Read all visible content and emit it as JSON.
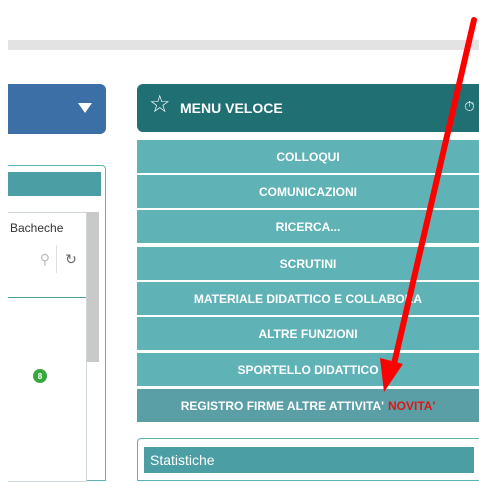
{
  "left": {
    "bacheche": "Bacheche",
    "badge": "8"
  },
  "menu_veloce": {
    "title": "MENU VELOCE",
    "items": [
      {
        "label": "COLLOQUI"
      },
      {
        "label": "COMUNICAZIONI"
      },
      {
        "label": "RICERCA..."
      },
      {
        "label": "SCRUTINI"
      },
      {
        "label": "MATERIALE DIDATTICO E COLLABORA"
      },
      {
        "label": "ALTRE FUNZIONI"
      },
      {
        "label": "SPORTELLO DIDATTICO"
      },
      {
        "label": "REGISTRO FIRME ALTRE ATTIVITA'",
        "tag": "NOVITA'"
      }
    ]
  },
  "stats": {
    "title": "Statistiche"
  },
  "colors": {
    "header": "#1f6f73",
    "menu_item": "#5fb2b6",
    "novita": "#e01515",
    "annotation_arrow": "#ff0000"
  },
  "icons": {
    "header": "star-icon",
    "clock": "clock-icon",
    "search": "search-icon",
    "refresh": "refresh-icon"
  }
}
